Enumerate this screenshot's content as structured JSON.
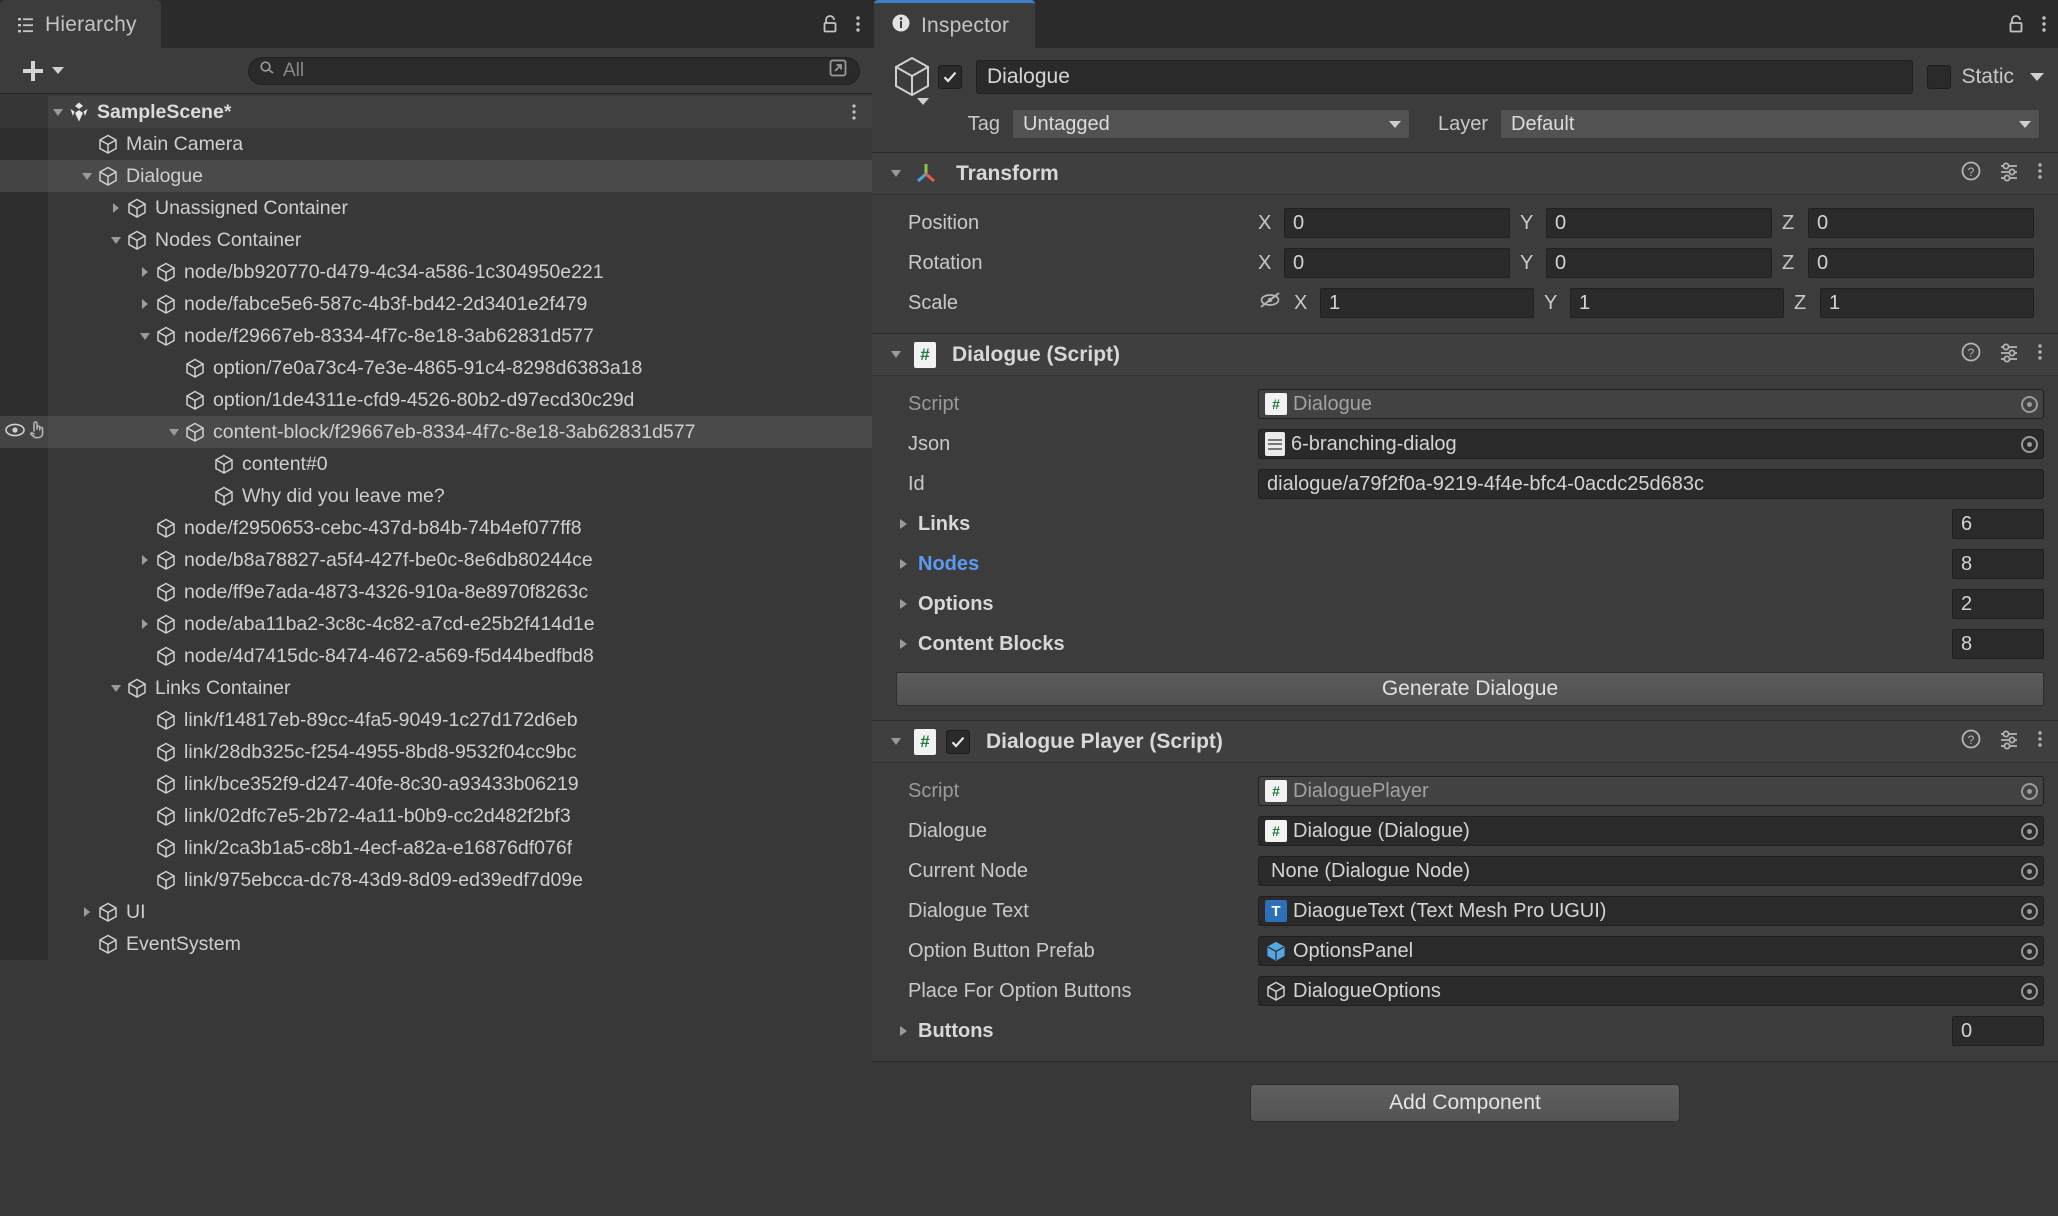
{
  "hierarchy": {
    "tab_label": "Hierarchy",
    "tab_icon": "hierarchy-icon",
    "lock_icon": "lock-icon",
    "menu_icon": "kebab-menu-icon",
    "create_label": "+",
    "search": {
      "placeholder": "All",
      "value": "",
      "icon": "search-icon",
      "popout_icon": "popout-icon"
    },
    "rows": [
      {
        "label": "SampleScene*",
        "depth": 1,
        "state": "open",
        "icon": "unity-scene-icon",
        "selected": false,
        "scene": true,
        "menu": true
      },
      {
        "label": "Main Camera",
        "depth": 2,
        "state": "leaf",
        "icon": "gameobject-cube-icon",
        "selected": false
      },
      {
        "label": "Dialogue",
        "depth": 2,
        "state": "open",
        "icon": "gameobject-cube-icon",
        "selected": true
      },
      {
        "label": "Unassigned Container",
        "depth": 3,
        "state": "closed",
        "icon": "gameobject-cube-icon",
        "selected": false
      },
      {
        "label": "Nodes Container",
        "depth": 3,
        "state": "open",
        "icon": "gameobject-cube-icon",
        "selected": false
      },
      {
        "label": "node/bb920770-d479-4c34-a586-1c304950e221",
        "depth": 4,
        "state": "closed",
        "icon": "gameobject-cube-icon",
        "selected": false
      },
      {
        "label": "node/fabce5e6-587c-4b3f-bd42-2d3401e2f479",
        "depth": 4,
        "state": "closed",
        "icon": "gameobject-cube-icon",
        "selected": false
      },
      {
        "label": "node/f29667eb-8334-4f7c-8e18-3ab62831d577",
        "depth": 4,
        "state": "open",
        "icon": "gameobject-cube-icon",
        "selected": false
      },
      {
        "label": "option/7e0a73c4-7e3e-4865-91c4-8298d6383a18",
        "depth": 5,
        "state": "leaf",
        "icon": "gameobject-cube-icon",
        "selected": false
      },
      {
        "label": "option/1de4311e-cfd9-4526-80b2-d97ecd30c29d",
        "depth": 5,
        "state": "leaf",
        "icon": "gameobject-cube-icon",
        "selected": false
      },
      {
        "label": "content-block/f29667eb-8334-4f7c-8e18-3ab62831d577",
        "depth": 5,
        "state": "open",
        "icon": "gameobject-cube-icon",
        "selected": true,
        "vis_icon": "eye-icon",
        "pick_icon": "hand-pointer-icon"
      },
      {
        "label": "content#0",
        "depth": 6,
        "state": "leaf",
        "icon": "gameobject-cube-icon",
        "selected": false
      },
      {
        "label": "Why did you leave me?",
        "depth": 6,
        "state": "leaf",
        "icon": "gameobject-cube-icon",
        "selected": false
      },
      {
        "label": "node/f2950653-cebc-437d-b84b-74b4ef077ff8",
        "depth": 4,
        "state": "leaf",
        "icon": "gameobject-cube-icon",
        "selected": false
      },
      {
        "label": "node/b8a78827-a5f4-427f-be0c-8e6db80244ce",
        "depth": 4,
        "state": "closed",
        "icon": "gameobject-cube-icon",
        "selected": false
      },
      {
        "label": "node/ff9e7ada-4873-4326-910a-8e8970f8263c",
        "depth": 4,
        "state": "leaf",
        "icon": "gameobject-cube-icon",
        "selected": false
      },
      {
        "label": "node/aba11ba2-3c8c-4c82-a7cd-e25b2f414d1e",
        "depth": 4,
        "state": "closed",
        "icon": "gameobject-cube-icon",
        "selected": false
      },
      {
        "label": "node/4d7415dc-8474-4672-a569-f5d44bedfbd8",
        "depth": 4,
        "state": "leaf",
        "icon": "gameobject-cube-icon",
        "selected": false
      },
      {
        "label": "Links Container",
        "depth": 3,
        "state": "open",
        "icon": "gameobject-cube-icon",
        "selected": false
      },
      {
        "label": "link/f14817eb-89cc-4fa5-9049-1c27d172d6eb",
        "depth": 4,
        "state": "leaf",
        "icon": "gameobject-cube-icon",
        "selected": false
      },
      {
        "label": "link/28db325c-f254-4955-8bd8-9532f04cc9bc",
        "depth": 4,
        "state": "leaf",
        "icon": "gameobject-cube-icon",
        "selected": false
      },
      {
        "label": "link/bce352f9-d247-40fe-8c30-a93433b06219",
        "depth": 4,
        "state": "leaf",
        "icon": "gameobject-cube-icon",
        "selected": false
      },
      {
        "label": "link/02dfc7e5-2b72-4a11-b0b9-cc2d482f2bf3",
        "depth": 4,
        "state": "leaf",
        "icon": "gameobject-cube-icon",
        "selected": false
      },
      {
        "label": "link/2ca3b1a5-c8b1-4ecf-a82a-e16876df076f",
        "depth": 4,
        "state": "leaf",
        "icon": "gameobject-cube-icon",
        "selected": false
      },
      {
        "label": "link/975ebcca-dc78-43d9-8d09-ed39edf7d09e",
        "depth": 4,
        "state": "leaf",
        "icon": "gameobject-cube-icon",
        "selected": false
      },
      {
        "label": "UI",
        "depth": 2,
        "state": "closed",
        "icon": "gameobject-cube-icon",
        "selected": false
      },
      {
        "label": "EventSystem",
        "depth": 2,
        "state": "leaf",
        "icon": "gameobject-cube-icon",
        "selected": false
      }
    ]
  },
  "inspector": {
    "tab_label": "Inspector",
    "tab_icon": "info-icon",
    "lock_icon": "lock-icon",
    "menu_icon": "kebab-menu-icon",
    "gameobject": {
      "enabled": true,
      "name": "Dialogue",
      "static_label": "Static",
      "tag_label": "Tag",
      "tag_value": "Untagged",
      "layer_label": "Layer",
      "layer_value": "Default",
      "icon": "gameobject-cube-icon"
    },
    "transform": {
      "title": "Transform",
      "icon": "transform-axis-icon",
      "help_icon": "help-icon",
      "preset_icon": "preset-icon",
      "menu_icon": "kebab-menu-icon",
      "rows": [
        {
          "name": "Position",
          "x": "0",
          "y": "0",
          "z": "0",
          "hidden_icon": null
        },
        {
          "name": "Rotation",
          "x": "0",
          "y": "0",
          "z": "0",
          "hidden_icon": null
        },
        {
          "name": "Scale",
          "x": "1",
          "y": "1",
          "z": "1",
          "hidden_icon": "eye-off-icon"
        }
      ],
      "axis_labels": [
        "X",
        "Y",
        "Z"
      ]
    },
    "dialogue_script": {
      "title": "Dialogue (Script)",
      "icon": "cs-script-icon",
      "help_icon": "help-icon",
      "preset_icon": "preset-icon",
      "menu_icon": "kebab-menu-icon",
      "fields": [
        {
          "name": "Script",
          "value": "Dialogue",
          "kind": "object-dim",
          "badge": "cs-script-icon"
        },
        {
          "name": "Json",
          "value": "6-branching-dialog",
          "kind": "object",
          "badge": "text-asset-icon"
        },
        {
          "name": "Id",
          "value": "dialogue/a79f2f0a-9219-4f4e-bfc4-0acdc25d683c",
          "kind": "text",
          "badge": null
        }
      ],
      "foldouts": [
        {
          "name": "Links",
          "count": "6",
          "accent": false
        },
        {
          "name": "Nodes",
          "count": "8",
          "accent": true
        },
        {
          "name": "Options",
          "count": "2",
          "accent": false
        },
        {
          "name": "Content Blocks",
          "count": "8",
          "accent": false
        }
      ],
      "button_label": "Generate Dialogue"
    },
    "dialogue_player_script": {
      "title": "Dialogue Player (Script)",
      "enabled": true,
      "icon": "cs-script-icon",
      "help_icon": "help-icon",
      "preset_icon": "preset-icon",
      "menu_icon": "kebab-menu-icon",
      "fields": [
        {
          "name": "Script",
          "value": "DialoguePlayer",
          "kind": "object-dim",
          "badge": "cs-script-icon"
        },
        {
          "name": "Dialogue",
          "value": "Dialogue (Dialogue)",
          "kind": "object",
          "badge": "cs-script-icon"
        },
        {
          "name": "Current Node",
          "value": "None (Dialogue Node)",
          "kind": "object",
          "badge": null
        },
        {
          "name": "Dialogue Text",
          "value": "DiaogueText (Text Mesh Pro UGUI)",
          "kind": "object",
          "badge": "tmp-icon"
        },
        {
          "name": "Option Button Prefab",
          "value": "OptionsPanel",
          "kind": "object",
          "badge": "prefab-icon"
        },
        {
          "name": "Place For Option Buttons",
          "value": "DialogueOptions",
          "kind": "object",
          "badge": "gameobject-cube-icon"
        }
      ],
      "foldouts": [
        {
          "name": "Buttons",
          "count": "0",
          "accent": false
        }
      ]
    },
    "add_component_label": "Add Component"
  },
  "colors": {
    "panel_bg": "#383838",
    "row_selected": "#4a4a4a",
    "accent_blue": "#5a9bf0",
    "tab_active_border": "#3b7fc4"
  }
}
